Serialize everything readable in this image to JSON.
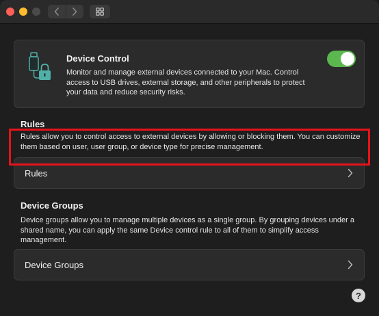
{
  "device_control": {
    "title": "Device Control",
    "description": "Monitor and manage external devices connected to your Mac. Control access to USB drives, external storage, and other peripherals to protect your data and reduce security risks.",
    "enabled": true,
    "toggle_color": "#5bb84e",
    "icon": "usb-lock-icon"
  },
  "rules": {
    "heading": "Rules",
    "description": "Rules allow you to control access to external devices by allowing or blocking them. You can customize them based on user, user group, or device type for precise management.",
    "row_label": "Rules"
  },
  "device_groups": {
    "heading": "Device Groups",
    "description": "Device groups allow you to manage multiple devices as a single group. By grouping devices under a shared name, you can apply the same Device control rule to all of them to simplify access management.",
    "row_label": "Device Groups"
  },
  "help": {
    "label": "?"
  },
  "colors": {
    "highlight": "#e8131a",
    "icon_teal": "#4fb0a8"
  }
}
